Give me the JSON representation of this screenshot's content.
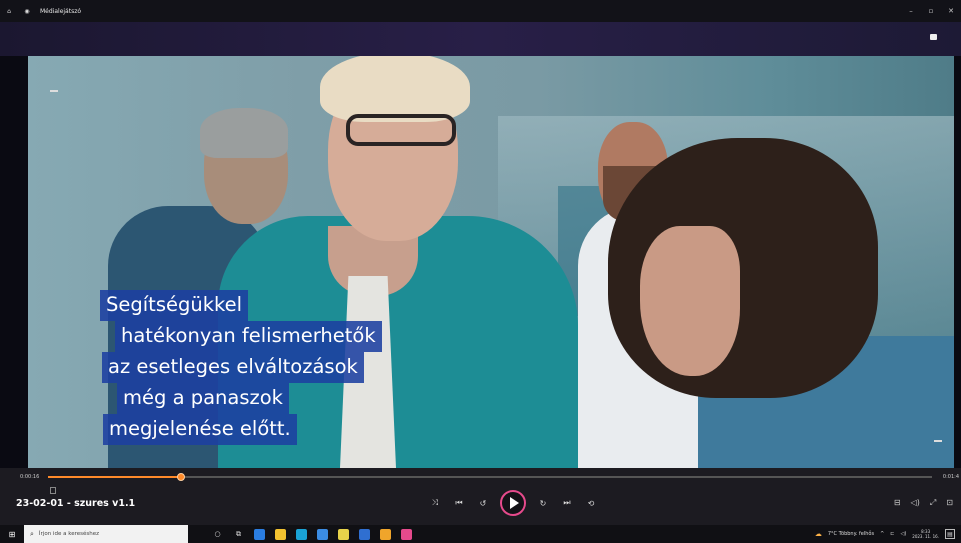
{
  "window": {
    "title": "Médialejátszó",
    "home_icon": "home-icon",
    "app_icon": "play-circle-icon",
    "controls": [
      "minimize-icon",
      "maximize-icon",
      "close-icon"
    ]
  },
  "video": {
    "subtitles": [
      "Segítségükkel",
      "hatékonyan felismerhetők",
      "az esetleges elváltozások",
      "még a panaszok",
      "megjelenése előtt."
    ]
  },
  "player": {
    "time_elapsed": "0:00:16",
    "time_total": "0:01:4",
    "progress": 0.15,
    "track_title": "23-02-01 - szures v1.1",
    "buttons": {
      "shuffle": "⤨",
      "previous": "⏮",
      "rewind": "↺",
      "forward": "↻",
      "next": "⏭",
      "repeat": "⟲"
    },
    "right_buttons": [
      "⊟",
      "◁)",
      "⤢",
      "⊡"
    ]
  },
  "taskbar": {
    "search_placeholder": "Írjon ide a kereséshez",
    "weather": "7°C Többny. felhős",
    "clock_time": "8:33",
    "clock_date": "2023. 11. 16.",
    "app_colors": [
      "#2a7de1",
      "#f2c230",
      "#1aa3d6",
      "#3b8ce3",
      "#e8d34a",
      "#2f6fd1",
      "#f0a52b",
      "#e64a8c"
    ]
  }
}
